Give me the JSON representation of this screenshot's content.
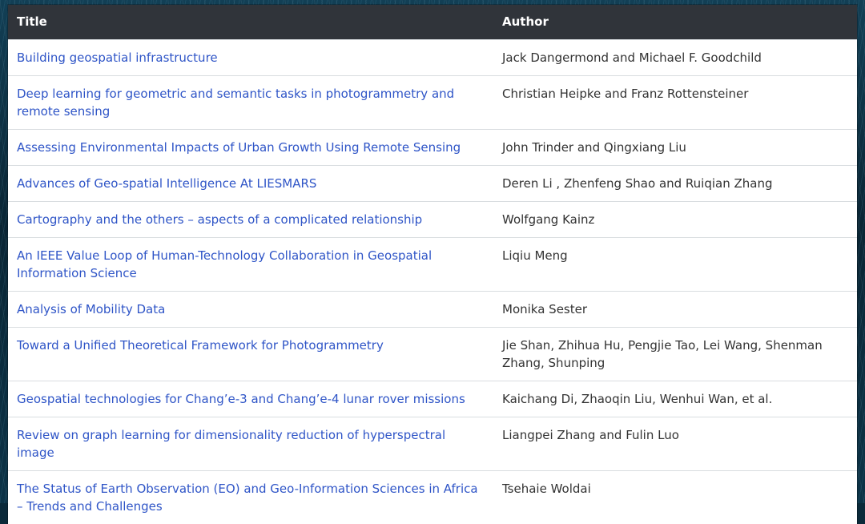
{
  "header": {
    "title": "Title",
    "author": "Author"
  },
  "rows": [
    {
      "title": "Building geospatial infrastructure",
      "author": "Jack Dangermond and Michael F. Goodchild"
    },
    {
      "title": "Deep learning for geometric and semantic tasks in photogrammetry and remote sensing",
      "author": "Christian Heipke and Franz Rottensteiner"
    },
    {
      "title": "Assessing Environmental Impacts of Urban Growth Using Remote Sensing",
      "author": "John Trinder and Qingxiang Liu"
    },
    {
      "title": "Advances of Geo-spatial Intelligence At LIESMARS",
      "author": "Deren Li , Zhenfeng Shao and Ruiqian Zhang"
    },
    {
      "title": "Cartography and the others – aspects of a complicated relationship",
      "author": "Wolfgang Kainz"
    },
    {
      "title": "An IEEE Value Loop of Human-Technology Collaboration in Geospatial Information Science",
      "author": "Liqiu Meng"
    },
    {
      "title": "Analysis of Mobility Data",
      "author": "Monika Sester"
    },
    {
      "title": "Toward a Unified Theoretical Framework for Photogrammetry",
      "author": "Jie Shan, Zhihua Hu, Pengjie Tao, Lei Wang, Shenman Zhang, Shunping"
    },
    {
      "title": "Geospatial technologies for Chang’e-3 and Chang’e-4 lunar rover missions",
      "author": "Kaichang Di, Zhaoqin Liu, Wenhui Wan, et al."
    },
    {
      "title": "Review on graph learning for dimensionality reduction of hyperspectral image",
      "author": "Liangpei Zhang and Fulin Luo"
    },
    {
      "title": "The Status of Earth Observation (EO) and Geo-Information Sciences in Africa – Trends and Challenges",
      "author": "Tsehaie Woldai"
    }
  ]
}
